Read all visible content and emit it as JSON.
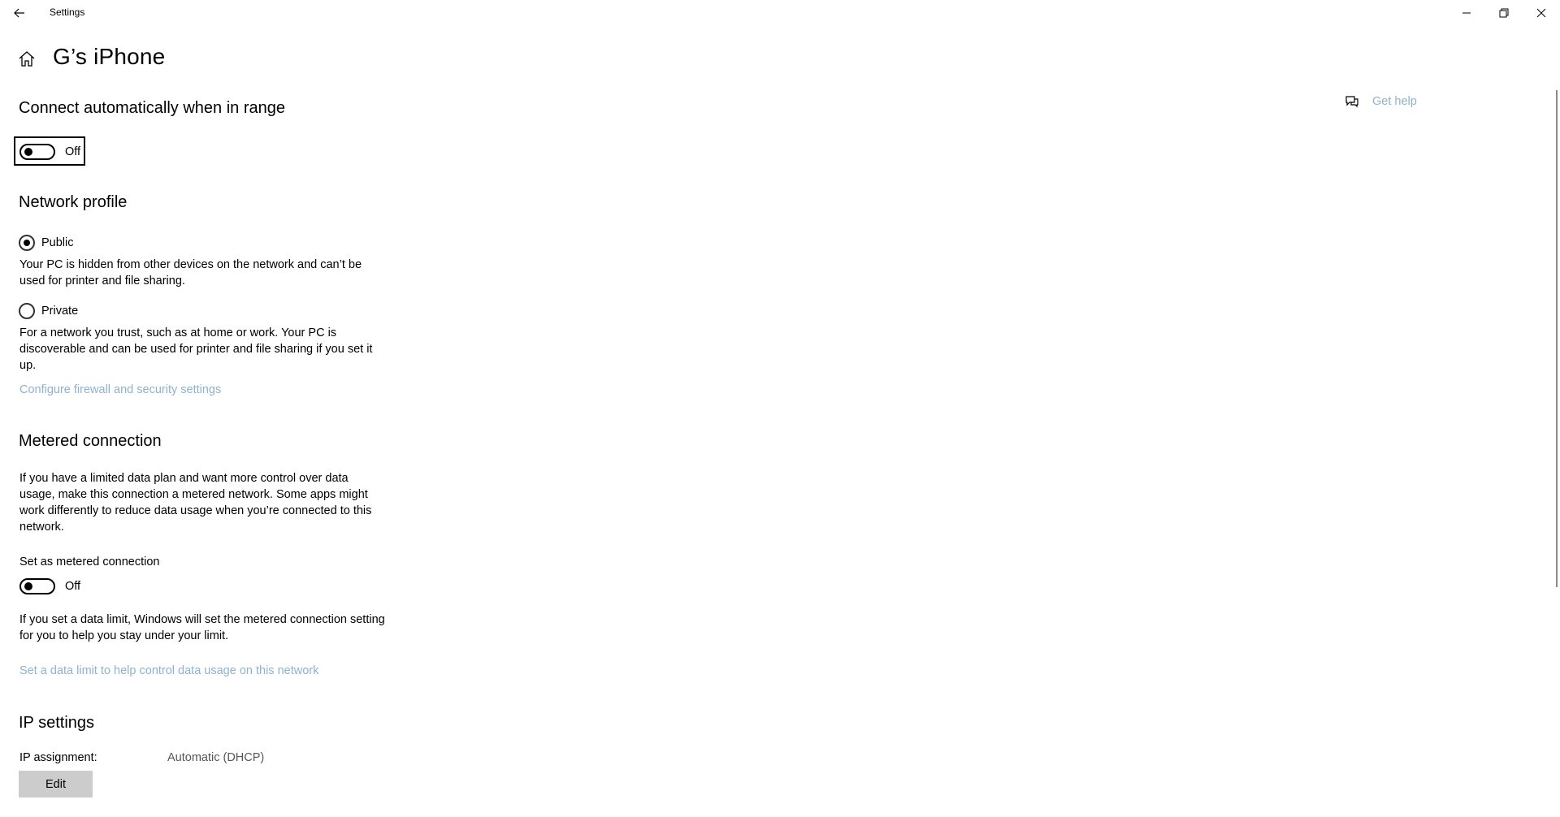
{
  "window": {
    "title": "Settings",
    "minimize_icon": "minimize-icon",
    "maximize_icon": "restore-icon",
    "close_icon": "close-icon"
  },
  "page": {
    "title": "G’s iPhone"
  },
  "connect_auto": {
    "heading": "Connect automatically when in range",
    "toggle_state": "Off"
  },
  "help": {
    "label": "Get help"
  },
  "network_profile": {
    "heading": "Network profile",
    "options": [
      {
        "label": "Public",
        "selected": true,
        "description": "Your PC is hidden from other devices on the network and can’t be used for printer and file sharing."
      },
      {
        "label": "Private",
        "selected": false,
        "description": "For a network you trust, such as at home or work. Your PC is discoverable and can be used for printer and file sharing if you set it up."
      }
    ],
    "firewall_link": "Configure firewall and security settings"
  },
  "metered": {
    "heading": "Metered connection",
    "description": "If you have a limited data plan and want more control over data usage, make this connection a metered network. Some apps might work differently to reduce data usage when you’re connected to this network.",
    "toggle_label": "Set as metered connection",
    "toggle_state": "Off",
    "limit_description": "If you set a data limit, Windows will set the metered connection setting for you to help you stay under your limit.",
    "limit_link": "Set a data limit to help control data usage on this network"
  },
  "ip_settings": {
    "heading": "IP settings",
    "assignment_label": "IP assignment:",
    "assignment_value": "Automatic (DHCP)",
    "edit_label": "Edit"
  }
}
